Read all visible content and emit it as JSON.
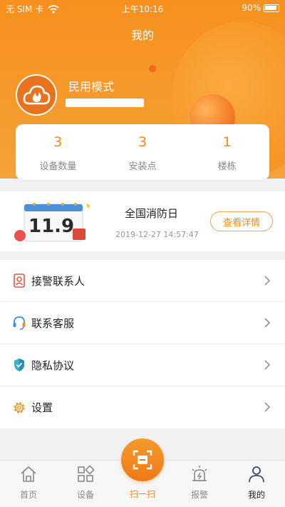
{
  "statusbar": {
    "carrier": "无 SIM 卡",
    "time": "上午10:16",
    "battery": "90%"
  },
  "page": {
    "title": "我的"
  },
  "profile": {
    "mode": "民用模式"
  },
  "stats": [
    {
      "value": "3",
      "label": "设备数量"
    },
    {
      "value": "3",
      "label": "安装点"
    },
    {
      "value": "1",
      "label": "楼栋"
    }
  ],
  "event": {
    "calendar_text": "11.9",
    "name": "全国消防日",
    "time": "2019-12-27 14:57:47",
    "button": "查看详情"
  },
  "menu": [
    {
      "label": "接警联系人",
      "icon": "contact-icon"
    },
    {
      "label": "联系客服",
      "icon": "headset-icon"
    },
    {
      "label": "隐私协议",
      "icon": "shield-icon"
    },
    {
      "label": "设置",
      "icon": "gear-icon"
    }
  ],
  "tabs": [
    {
      "label": "首页",
      "icon": "home-icon"
    },
    {
      "label": "设备",
      "icon": "devices-icon"
    },
    {
      "label": "扫一扫",
      "icon": "scan-icon"
    },
    {
      "label": "报警",
      "icon": "alarm-icon"
    },
    {
      "label": "我的",
      "icon": "user-icon"
    }
  ],
  "colors": {
    "accent": "#f08c1f",
    "header": "#f7901e"
  }
}
